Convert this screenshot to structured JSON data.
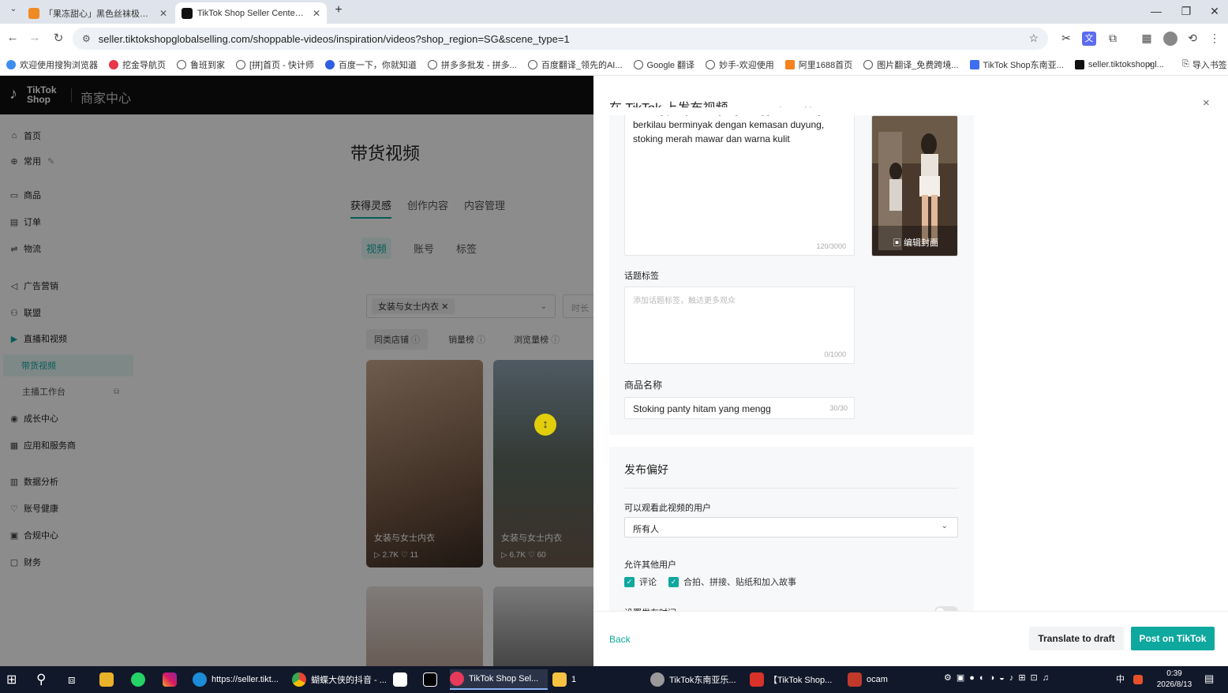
{
  "browser": {
    "tabs": [
      {
        "title": "「果冻甜心」黑色丝袜极光油光",
        "active": false
      },
      {
        "title": "TikTok Shop Seller Center | C",
        "active": true
      }
    ],
    "new_tab": "+",
    "window_controls": {
      "minimize": "—",
      "restore": "❐",
      "close": "✕"
    },
    "url": "seller.tiktokshopglobalselling.com/shoppable-videos/inspiration/videos?shop_region=SG&scene_type=1",
    "bookmarks": [
      "欢迎使用搜狗浏览器",
      "挖金导航页",
      "鲁班到家",
      "[拼]首页 - 快计师",
      "百度一下，你就知道",
      "拼多多批发 - 拼多...",
      "百度翻译_领先的AI...",
      "Google 翻译",
      "妙手-欢迎使用",
      "阿里1688首页",
      "图片翻译_免费跨境...",
      "TikTok Shop东南亚...",
      "seller.tiktokshopgl..."
    ],
    "bookmarks_more": "»",
    "import_bookmarks": "导入书签"
  },
  "seller": {
    "logo": "TikTok Shop",
    "logo_sub": "商家中心",
    "sidebar": [
      {
        "icon": "⌂",
        "label": "首页"
      },
      {
        "icon": "⊕",
        "label": "常用"
      },
      {
        "icon": "▭",
        "label": "商品"
      },
      {
        "icon": "▤",
        "label": "订单"
      },
      {
        "icon": "⇌",
        "label": "物流"
      },
      {
        "icon": "◁",
        "label": "广告营销"
      },
      {
        "icon": "⚇",
        "label": "联盟"
      },
      {
        "icon": "▶",
        "label": "直播和视频"
      },
      {
        "icon": "",
        "label": "带货视频"
      },
      {
        "icon": "",
        "label": "主播工作台"
      },
      {
        "icon": "◉",
        "label": "成长中心"
      },
      {
        "icon": "▦",
        "label": "应用和服务商"
      },
      {
        "icon": "▥",
        "label": "数据分析"
      },
      {
        "icon": "♡",
        "label": "账号健康"
      },
      {
        "icon": "▣",
        "label": "合规中心"
      },
      {
        "icon": "▢",
        "label": "财务"
      }
    ],
    "page_title": "带货视频",
    "tabs": [
      "获得灵感",
      "创作内容",
      "内容管理"
    ],
    "subtabs": [
      "视频",
      "账号",
      "标签"
    ],
    "filter_chip": "女装与女士内衣",
    "filter2": "时长",
    "pills": [
      "同类店铺",
      "销量榜",
      "浏览量榜"
    ],
    "cards": [
      {
        "caption": "女装与女士内衣",
        "views": "2.7K",
        "likes": "11"
      },
      {
        "caption": "女装与女士内衣",
        "views": "6.7K",
        "likes": "60"
      }
    ]
  },
  "drawer": {
    "title": "在 TikTok 上发布视频",
    "close": "×",
    "description_lines": [
      "Stoking panty hitam yang menggoda, stoking",
      "berkilau berminyak dengan kemasan duyung,",
      "stoking merah mawar dan warna kulit"
    ],
    "description_counter": "120/3000",
    "edit_cover": "编辑封面",
    "hashtag_label": "话题标签",
    "hashtag_placeholder": "添加话题标签，触达更多观众",
    "hashtag_counter": "0/1000",
    "product_name_label": "商品名称",
    "product_name_value": "Stoking panty hitam yang mengg",
    "product_name_counter": "30/30",
    "prefs_title": "发布偏好",
    "audience_label": "可以观看此视频的用户",
    "audience_value": "所有人",
    "allow_label": "允许其他用户",
    "allow_options": [
      "评论",
      "合拍、拼接、贴纸和加入故事"
    ],
    "schedule_label": "设置发布时间",
    "back": "Back",
    "draft_btn": "Translate to draft",
    "post_btn": "Post on TikTok"
  },
  "taskbar": {
    "items": [
      "https://seller.tikt...",
      "蝴蝶大侠的抖音 - ...",
      "TikTok Shop Sel...",
      "1",
      "TikTok东南亚乐...",
      "【TikTok Shop...",
      "ocam"
    ],
    "ime": "中",
    "time": "0:39",
    "date": "2026/8/13"
  }
}
